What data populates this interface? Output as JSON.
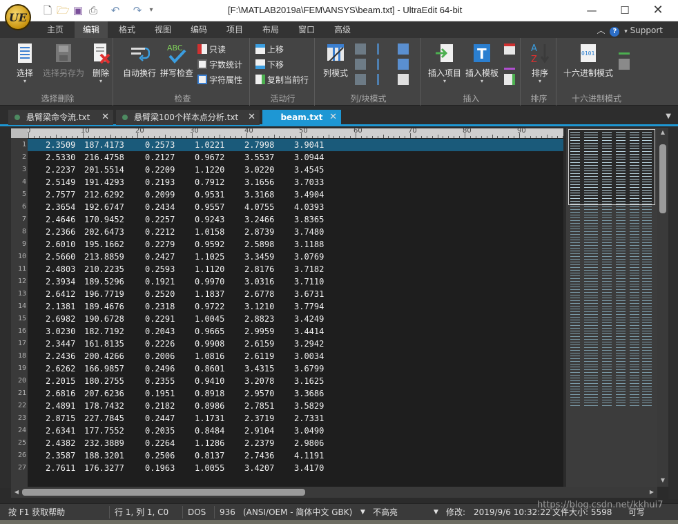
{
  "window": {
    "title": "[F:\\MATLAB2019a\\FEM\\ANSYS\\beam.txt] - UltraEdit 64-bit",
    "logo_text": "UE"
  },
  "ribbon_tabs": [
    {
      "label": "主页"
    },
    {
      "label": "编辑"
    },
    {
      "label": "格式"
    },
    {
      "label": "视图"
    },
    {
      "label": "编码"
    },
    {
      "label": "项目"
    },
    {
      "label": "布局"
    },
    {
      "label": "窗口"
    },
    {
      "label": "高级"
    }
  ],
  "support_label": "Support",
  "groups": {
    "select_delete": {
      "label": "选择删除",
      "select": "选择",
      "select_save_as": "选择另存为",
      "delete": "删除"
    },
    "check": {
      "label": "检查",
      "auto_wrap": "自动换行",
      "spell_check": "拼写检查",
      "read_only": "只读",
      "word_count": "字数统计",
      "char_props": "字符属性"
    },
    "active_line": {
      "label": "活动行",
      "move_up": "上移",
      "move_down": "下移",
      "copy_line": "复制当前行"
    },
    "column_block": {
      "label": "列/块模式",
      "column_mode": "列模式"
    },
    "insert": {
      "label": "插入",
      "insert_item": "插入项目",
      "insert_template": "插入模板"
    },
    "sort": {
      "label": "排序",
      "sort": "排序"
    },
    "hex": {
      "label": "十六进制模式",
      "hex_mode": "十六进制模式"
    }
  },
  "file_tabs": [
    {
      "label": "悬臂梁命令流.txt"
    },
    {
      "label": "悬臂梁100个样本点分析.txt"
    },
    {
      "label": "beam.txt"
    }
  ],
  "ruler_labels": [
    "0",
    "10",
    "20",
    "30",
    "40",
    "50",
    "60",
    "70",
    "80",
    "90"
  ],
  "editor_rows": [
    [
      "2.3509",
      "187.4173",
      "0.2573",
      "1.0221",
      "2.7998",
      "3.9041"
    ],
    [
      "2.5330",
      "216.4758",
      "0.2127",
      "0.9672",
      "3.5537",
      "3.0944"
    ],
    [
      "2.2237",
      "201.5514",
      "0.2209",
      "1.1220",
      "3.0220",
      "3.4545"
    ],
    [
      "2.5149",
      "191.4293",
      "0.2193",
      "0.7912",
      "3.1656",
      "3.7033"
    ],
    [
      "2.7577",
      "212.6292",
      "0.2099",
      "0.9531",
      "3.3168",
      "3.4904"
    ],
    [
      "2.3654",
      "192.6747",
      "0.2434",
      "0.9557",
      "4.0755",
      "4.0393"
    ],
    [
      "2.4646",
      "170.9452",
      "0.2257",
      "0.9243",
      "3.2466",
      "3.8365"
    ],
    [
      "2.2366",
      "202.6473",
      "0.2212",
      "1.0158",
      "2.8739",
      "3.7480"
    ],
    [
      "2.6010",
      "195.1662",
      "0.2279",
      "0.9592",
      "2.5898",
      "3.1188"
    ],
    [
      "2.5660",
      "213.8859",
      "0.2427",
      "1.1025",
      "3.3459",
      "3.0769"
    ],
    [
      "2.4803",
      "210.2235",
      "0.2593",
      "1.1120",
      "2.8176",
      "3.7182"
    ],
    [
      "2.3934",
      "189.5296",
      "0.1921",
      "0.9970",
      "3.0316",
      "3.7110"
    ],
    [
      "2.6412",
      "196.7719",
      "0.2520",
      "1.1837",
      "2.6778",
      "3.6731"
    ],
    [
      "2.1381",
      "189.4676",
      "0.2318",
      "0.9722",
      "3.1210",
      "3.7794"
    ],
    [
      "2.6982",
      "190.6728",
      "0.2291",
      "1.0045",
      "2.8823",
      "3.4249"
    ],
    [
      "3.0230",
      "182.7192",
      "0.2043",
      "0.9665",
      "2.9959",
      "3.4414"
    ],
    [
      "2.3447",
      "161.8135",
      "0.2226",
      "0.9908",
      "2.6159",
      "3.2942"
    ],
    [
      "2.2436",
      "200.4266",
      "0.2006",
      "1.0816",
      "2.6119",
      "3.0034"
    ],
    [
      "2.6262",
      "166.9857",
      "0.2496",
      "0.8601",
      "3.4315",
      "3.6799"
    ],
    [
      "2.2015",
      "180.2755",
      "0.2355",
      "0.9410",
      "3.2078",
      "3.1625"
    ],
    [
      "2.6816",
      "207.6236",
      "0.1951",
      "0.8918",
      "2.9570",
      "3.3686"
    ],
    [
      "2.4891",
      "178.7432",
      "0.2182",
      "0.8986",
      "2.7851",
      "3.5829"
    ],
    [
      "2.8715",
      "227.7845",
      "0.2447",
      "1.1731",
      "2.3719",
      "2.7331"
    ],
    [
      "2.6341",
      "177.7552",
      "0.2035",
      "0.8484",
      "2.9104",
      "3.0490"
    ],
    [
      "2.4382",
      "232.3889",
      "0.2264",
      "1.1286",
      "2.2379",
      "2.9806"
    ],
    [
      "2.3587",
      "188.3201",
      "0.2506",
      "0.8137",
      "2.7436",
      "4.1191"
    ],
    [
      "2.7611",
      "176.3277",
      "0.1963",
      "1.0055",
      "3.4207",
      "3.4170"
    ]
  ],
  "status": {
    "help": "按 F1 获取帮助",
    "position": "行 1, 列 1, C0",
    "line_ending": "DOS",
    "codepage": "936",
    "encoding": "(ANSI/OEM - 简体中文 GBK)",
    "highlight": "不高亮",
    "modified": "修改:",
    "modified_time": "2019/9/6 10:32:22",
    "file_size": "文件大小: 5598",
    "writable": "可写",
    "watermark": "https://blog.csdn.net/kkhui7"
  },
  "colors": {
    "accent": "#1e97d4",
    "current_line": "#1a5a7a"
  }
}
